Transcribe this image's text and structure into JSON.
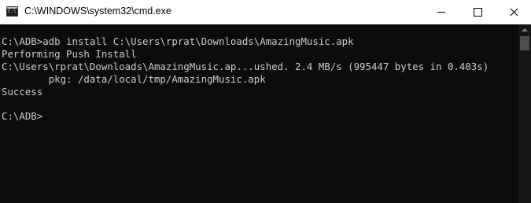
{
  "window": {
    "title": "C:\\WINDOWS\\system32\\cmd.exe",
    "icon": "cmd-console-icon",
    "icon_text": "C:\\",
    "controls": {
      "minimize": "minimize-icon",
      "maximize": "maximize-icon",
      "close": "close-icon"
    }
  },
  "console": {
    "lines": [
      "C:\\ADB>adb install C:\\Users\\rprat\\Downloads\\AmazingMusic.apk",
      "Performing Push Install",
      "C:\\Users\\rprat\\Downloads\\AmazingMusic.ap...ushed. 2.4 MB/s (995447 bytes in 0.403s)",
      "        pkg: /data/local/tmp/AmazingMusic.apk",
      "Success",
      "",
      "C:\\ADB>"
    ],
    "text_color": "#cccccc",
    "background": "#0c0c0c"
  }
}
